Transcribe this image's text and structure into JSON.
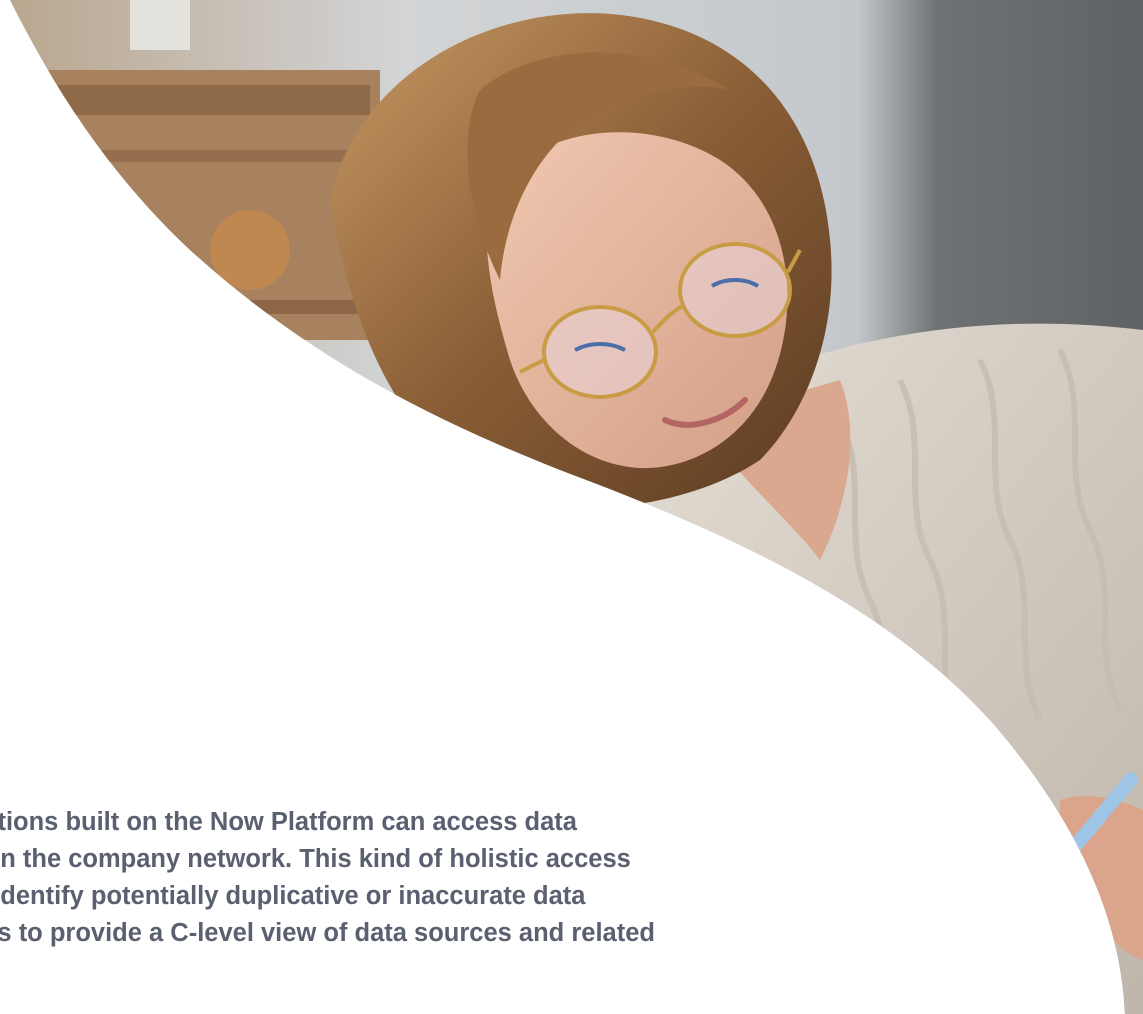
{
  "photo": {
    "subject_icon": "woman-writing-photo",
    "colors": {
      "wall": "#c9cdd3",
      "wall_dark": "#6f7274",
      "shelf": "#a8825f",
      "hair": "#8a5e36",
      "skin": "#e3b49b",
      "sweater": "#d9d1c7",
      "white": "#ffffff"
    }
  },
  "body": {
    "lines": [
      "ications built on the Now Platform can access data",
      "d on the company network. This kind of holistic access",
      "to identify potentially duplicative or inaccurate data",
      "EAs to provide a C-level view of data sources and related"
    ],
    "text_color": "#5a6070"
  }
}
